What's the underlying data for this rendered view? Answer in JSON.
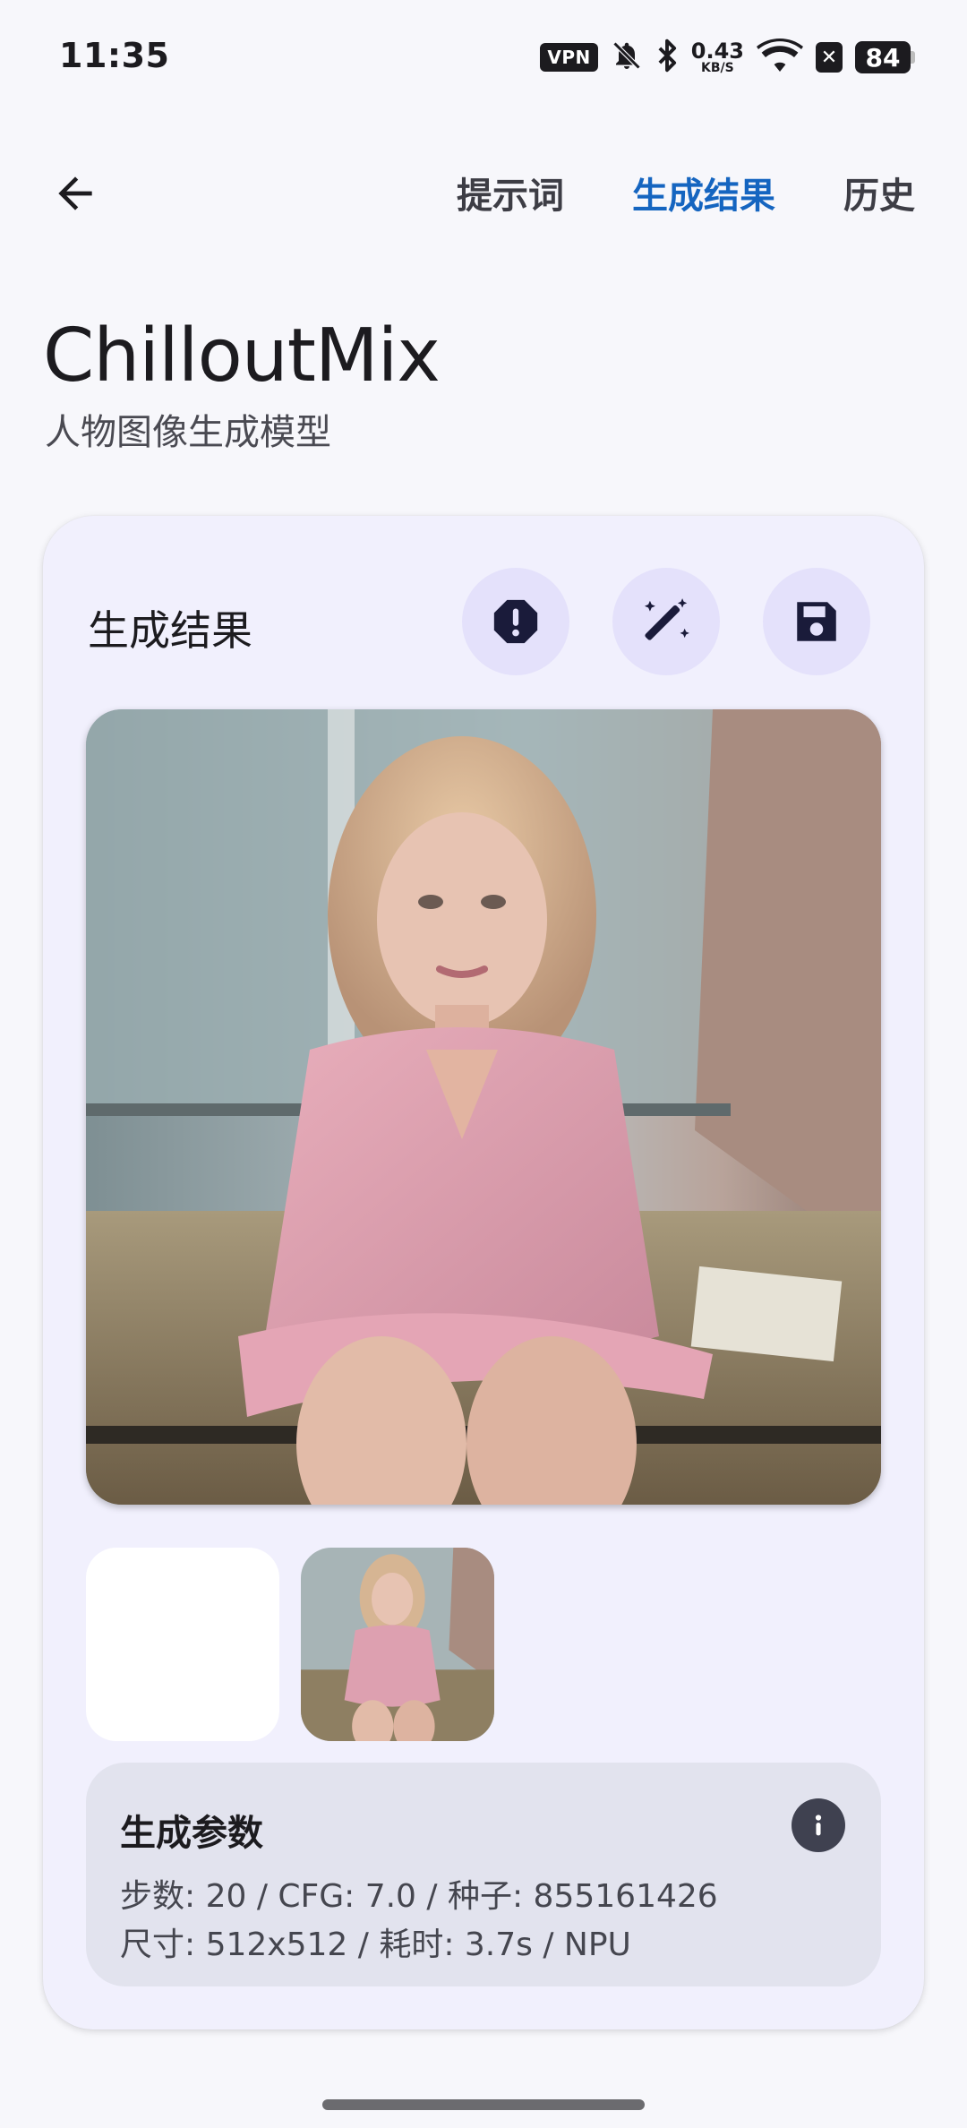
{
  "status_bar": {
    "time": "11:35",
    "vpn": "VPN",
    "speed_value": "0.43",
    "speed_unit": "KB/S",
    "battery": "84",
    "icons": [
      "vpn-icon",
      "bell-off-icon",
      "bluetooth-icon",
      "network-speed",
      "wifi-icon",
      "x-icon",
      "battery-icon"
    ]
  },
  "app_bar": {
    "back_icon": "arrow-left-icon",
    "tabs": [
      {
        "label": "提示词",
        "active": false
      },
      {
        "label": "生成结果",
        "active": true
      },
      {
        "label": "历史",
        "active": false
      }
    ]
  },
  "header": {
    "title": "ChilloutMix",
    "subtitle": "人物图像生成模型"
  },
  "result_card": {
    "title": "生成结果",
    "actions": [
      {
        "name": "report",
        "icon": "alert-octagon-icon"
      },
      {
        "name": "magic",
        "icon": "magic-wand-icon"
      },
      {
        "name": "save",
        "icon": "floppy-disk-icon"
      }
    ],
    "main_image_alt": "generated portrait image",
    "thumbnails": [
      "empty",
      "generated"
    ],
    "params": {
      "title": "生成参数",
      "line1": "步数: 20 / CFG: 7.0 / 种子: 855161426",
      "line2": "尺寸: 512x512 / 耗时: 3.7s / NPU",
      "info_icon": "info-icon"
    }
  },
  "colors": {
    "accent": "#1565C0",
    "card_bg": "#F1F0FD",
    "action_bg": "#E4E1FB",
    "params_bg": "#E2E3EE"
  }
}
